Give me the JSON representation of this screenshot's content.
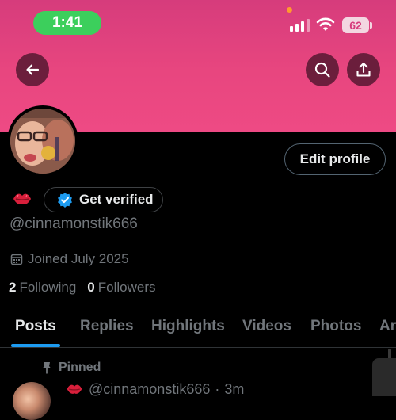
{
  "status_bar": {
    "time": "1:41",
    "battery": "62"
  },
  "profile": {
    "edit_label": "Edit profile",
    "verify_label": "Get verified",
    "handle": "@cinnamonstik666",
    "joined": "Joined July 2025",
    "following_count": "2",
    "following_label": "Following",
    "followers_count": "0",
    "followers_label": "Followers"
  },
  "tabs": [
    {
      "label": "Posts",
      "active": true
    },
    {
      "label": "Replies"
    },
    {
      "label": "Highlights"
    },
    {
      "label": "Videos"
    },
    {
      "label": "Photos"
    },
    {
      "label": "Ar"
    }
  ],
  "pinned_post": {
    "pinned_label": "Pinned",
    "author_handle": "@cinnamonstik666",
    "separator": "·",
    "time_ago": "3m"
  },
  "icons": {
    "back": "arrow-left-icon",
    "search": "search-icon",
    "share": "share-icon",
    "calendar": "calendar-icon",
    "pin": "pin-icon",
    "verified": "verified-badge-icon",
    "lips": "kiss-mark-icon"
  },
  "colors": {
    "banner": "#e8467f",
    "accent": "#1d9bf0",
    "time_pill": "#3ccf5c"
  }
}
